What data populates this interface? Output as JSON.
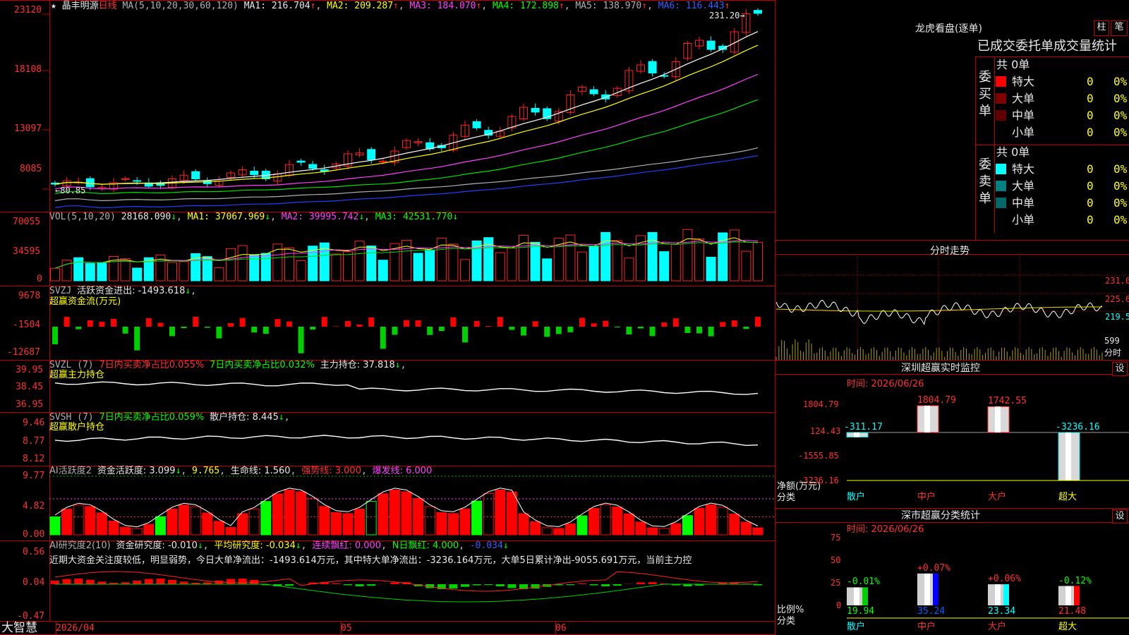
{
  "stock": {
    "name": "晶丰明源",
    "period": "日线",
    "star": "★"
  },
  "ma_header": {
    "params": "MA(5,10,20,30,60,120)",
    "ma1": "MA1: 216.704",
    "ma2": "MA2: 209.287",
    "ma3": "MA3: 184.070",
    "ma4": "MA4: 172.898",
    "ma5": "MA5: 138.970",
    "ma6": "MA6: 116.443"
  },
  "price_axis": [
    "23120",
    "18108",
    "13097",
    "8085"
  ],
  "price_marks": {
    "high": "231.20",
    "low": "80.85"
  },
  "vol_header": {
    "params": "VOL(5,10,20)",
    "v": "28168.090",
    "ma1": "MA1: 37067.969",
    "ma2": "MA2: 39995.742",
    "ma3": "MA3: 42531.770"
  },
  "vol_axis": [
    "70055",
    "34595",
    "0"
  ],
  "svzj": {
    "label": "SVZJ",
    "text": "活跃资金进出: -1493.618",
    "sub": "超赢资金流(万元)",
    "axis": [
      "9678",
      "-1504",
      "-12687"
    ]
  },
  "svzl": {
    "label": "SVZL (7)",
    "t1": "7日内买卖净占比0.055%",
    "t2": "7日内买卖净占比0.032%",
    "t3": "主力持仓: 37.818",
    "sub": "超赢主力持仓",
    "axis": [
      "39.95",
      "38.45",
      "36.95"
    ]
  },
  "svsh": {
    "label": "SVSH (7)",
    "t1": "7日内买卖净占比0.059%",
    "t2": "散户持仓: 8.445",
    "sub": "超赢散户持仓",
    "axis": [
      "9.46",
      "8.77",
      "8.12"
    ]
  },
  "ai_active": {
    "label": "AI活跃度2",
    "t1": "资金活跃度: 3.099",
    "t2": "9.765",
    "t3": "生命线: 1.560",
    "t4": "强势线: 3.000",
    "t5": "爆发线: 6.000",
    "axis": [
      "9.77",
      "4.82",
      "0.00"
    ]
  },
  "ai_research": {
    "label": "AI研究度2(10)",
    "t1": "资金研究度: -0.010",
    "t2": "平均研究度: -0.034",
    "t3": "连续飘红: 0.000",
    "t4": "N日飘红: 4.000",
    "t5": "-0.034",
    "comment": "近期大资金关注度较低，明显弱势，今日大单净流出：-1493.614万元，其中特大单净流出：-3236.164万元，大单5日累计净出-9055.691万元，当前主力控",
    "axis": [
      "0.56",
      "0.04",
      "-0.47"
    ]
  },
  "date_axis": [
    "2026/04",
    "05",
    "06"
  ],
  "logo": "大智慧",
  "longhu": {
    "title": "龙虎看盘(逐单)",
    "btn1": "柱",
    "btn2": "笔",
    "subtitle": "已成交委托单成交量统计",
    "buy": {
      "side": "委买单",
      "total": "共 0单",
      "rows": [
        {
          "label": "特大",
          "n": "0",
          "p": "0%"
        },
        {
          "label": "大单",
          "n": "0",
          "p": "0%"
        },
        {
          "label": "中单",
          "n": "0",
          "p": "0%"
        },
        {
          "label": "小单",
          "n": "0",
          "p": "0%"
        }
      ]
    },
    "sell": {
      "side": "委卖单",
      "total": "共 0单",
      "rows": [
        {
          "label": "特大",
          "n": "0",
          "p": "0%"
        },
        {
          "label": "大单",
          "n": "0",
          "p": "0%"
        },
        {
          "label": "中单",
          "n": "0",
          "p": "0%"
        },
        {
          "label": "小单",
          "n": "0",
          "p": "0%"
        }
      ]
    }
  },
  "intraday": {
    "title": "分时走势",
    "axis": [
      "231.6",
      "225.6",
      "219.5"
    ],
    "vol_axis": [
      "599",
      "分时"
    ]
  },
  "monitor": {
    "title": "深圳超赢实时监控",
    "btn": "设",
    "date": "时间: 2026/06/26",
    "axis": [
      "1804.79",
      "124.43",
      "-1555.85",
      "-3236.16"
    ],
    "ylab": "净额(万元)",
    "xlab": "分类",
    "bars": [
      {
        "cat": "散户",
        "v": "-311.17",
        "val": -311.17
      },
      {
        "cat": "中户",
        "v": "1804.79",
        "val": 1804.79
      },
      {
        "cat": "大户",
        "v": "1742.55",
        "val": 1742.55
      },
      {
        "cat": "超大",
        "v": "-3236.16",
        "val": -3236.16
      }
    ]
  },
  "classify": {
    "title": "深市超赢分类统计",
    "btn": "设",
    "date": "时间: 2026/06/26",
    "axis": [
      "75",
      "50",
      "25",
      "0"
    ],
    "ylab": "比例%",
    "xlab": "分类",
    "bars": [
      {
        "cat": "散户",
        "top": "-0.01%",
        "val": 19.94,
        "bottom": "19.94"
      },
      {
        "cat": "中户",
        "top": "+0.07%",
        "val": 35.24,
        "bottom": "35.24"
      },
      {
        "cat": "大户",
        "top": "+0.06%",
        "val": 23.34,
        "bottom": "23.34"
      },
      {
        "cat": "超大",
        "top": "-0.12%",
        "val": 21.48,
        "bottom": "21.48"
      }
    ]
  },
  "colors": {
    "up": "#ff2020",
    "down": "#00ffff",
    "grid": "#c00000",
    "ma1": "#ffffff",
    "ma2": "#ffff00",
    "ma3": "#ff40ff",
    "ma4": "#00e000",
    "ma5": "#b0b0b0",
    "ma6": "#2040ff"
  }
}
